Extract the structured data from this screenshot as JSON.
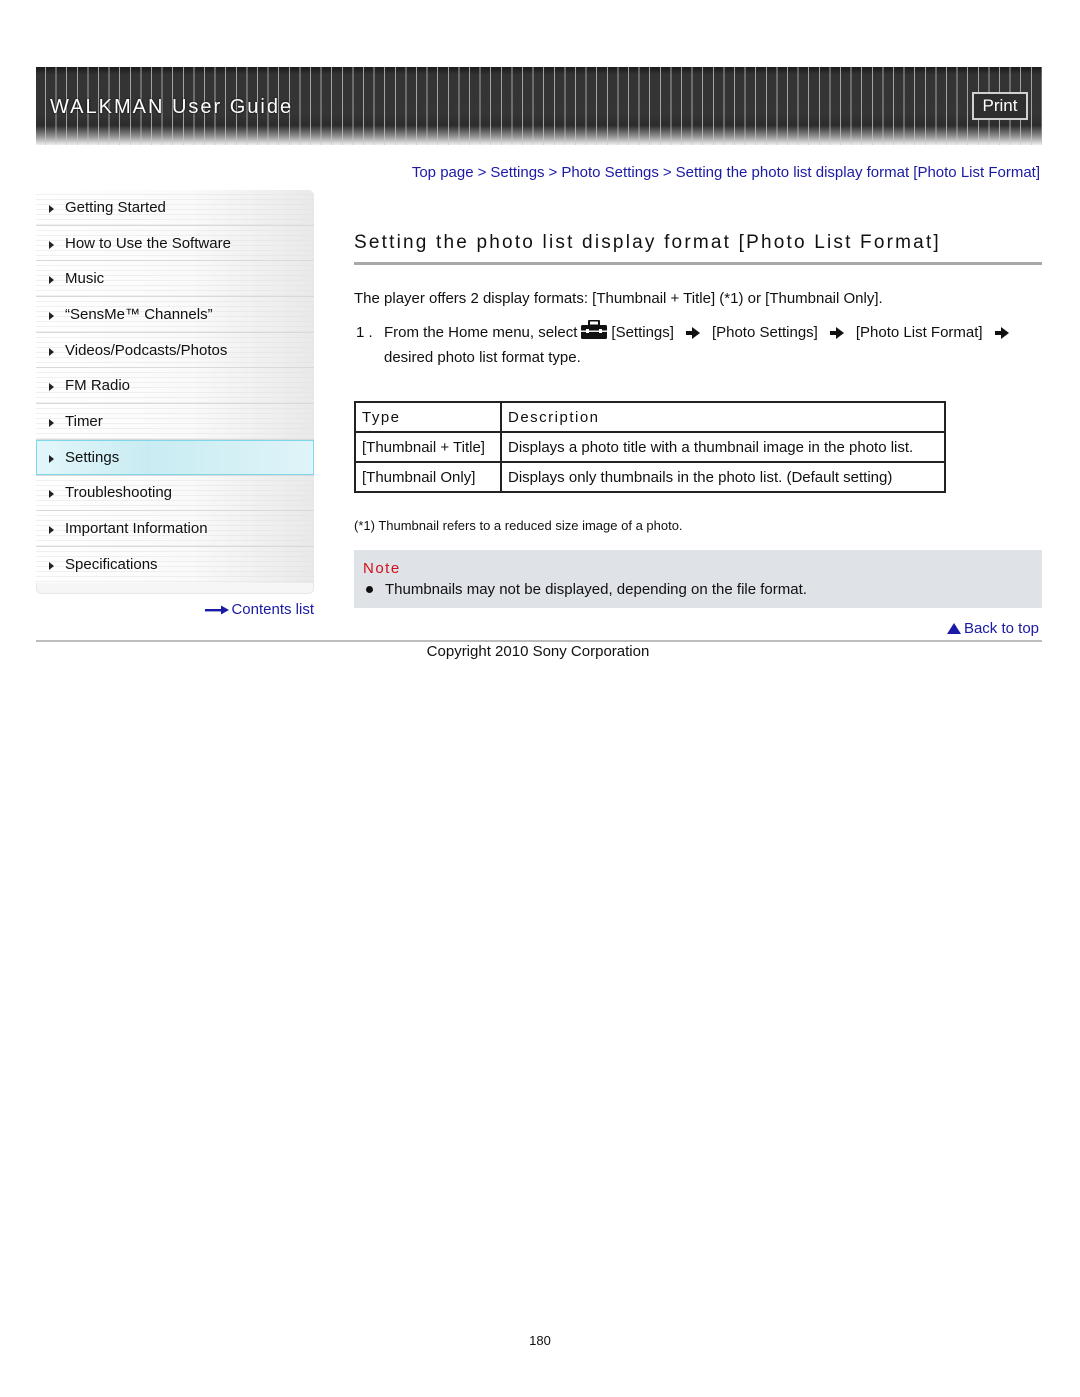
{
  "header": {
    "title": "WALKMAN User Guide",
    "print_label": "Print"
  },
  "breadcrumb": {
    "items": [
      "Top page",
      "Settings",
      "Photo Settings",
      "Setting the photo list display format [Photo List Format]"
    ],
    "separator": ">"
  },
  "sidebar": {
    "items": [
      {
        "label": "Getting Started",
        "active": false
      },
      {
        "label": "How to Use the Software",
        "active": false
      },
      {
        "label": "Music",
        "active": false
      },
      {
        "label": "“SensMe™ Channels”",
        "active": false
      },
      {
        "label": "Videos/Podcasts/Photos",
        "active": false
      },
      {
        "label": "FM Radio",
        "active": false
      },
      {
        "label": "Timer",
        "active": false
      },
      {
        "label": "Settings",
        "active": true
      },
      {
        "label": "Troubleshooting",
        "active": false
      },
      {
        "label": "Important Information",
        "active": false
      },
      {
        "label": "Specifications",
        "active": false
      }
    ],
    "contents_link": "Contents list"
  },
  "main": {
    "title": "Setting the photo list display format [Photo List Format]",
    "intro": "The player offers 2 display formats: [Thumbnail + Title] (*1) or [Thumbnail Only].",
    "step": {
      "number": "1 .",
      "prefix": "From the Home menu, select",
      "icon": "toolbox-icon",
      "path": [
        "[Settings]",
        "[Photo Settings]",
        "[Photo List Format]"
      ],
      "suffix": "desired photo list format type."
    },
    "table": {
      "headers": [
        "Type",
        "Description"
      ],
      "rows": [
        [
          "[Thumbnail + Title]",
          "Displays a photo title with a thumbnail image in the photo list."
        ],
        [
          "[Thumbnail Only]",
          "Displays only thumbnails in the photo list. (Default setting)"
        ]
      ]
    },
    "footnote": "(*1) Thumbnail refers to a reduced size image of a photo.",
    "note": {
      "title": "Note",
      "items": [
        "Thumbnails may not be displayed, depending on the file format."
      ]
    },
    "back_to_top": "Back to top"
  },
  "footer": {
    "copyright": "Copyright 2010 Sony Corporation",
    "page_number": "180"
  },
  "colors": {
    "link": "#1a1aa6",
    "note_title": "#d0101a",
    "note_bg": "#dfe2e6",
    "active_item": "#c9ecf2"
  }
}
